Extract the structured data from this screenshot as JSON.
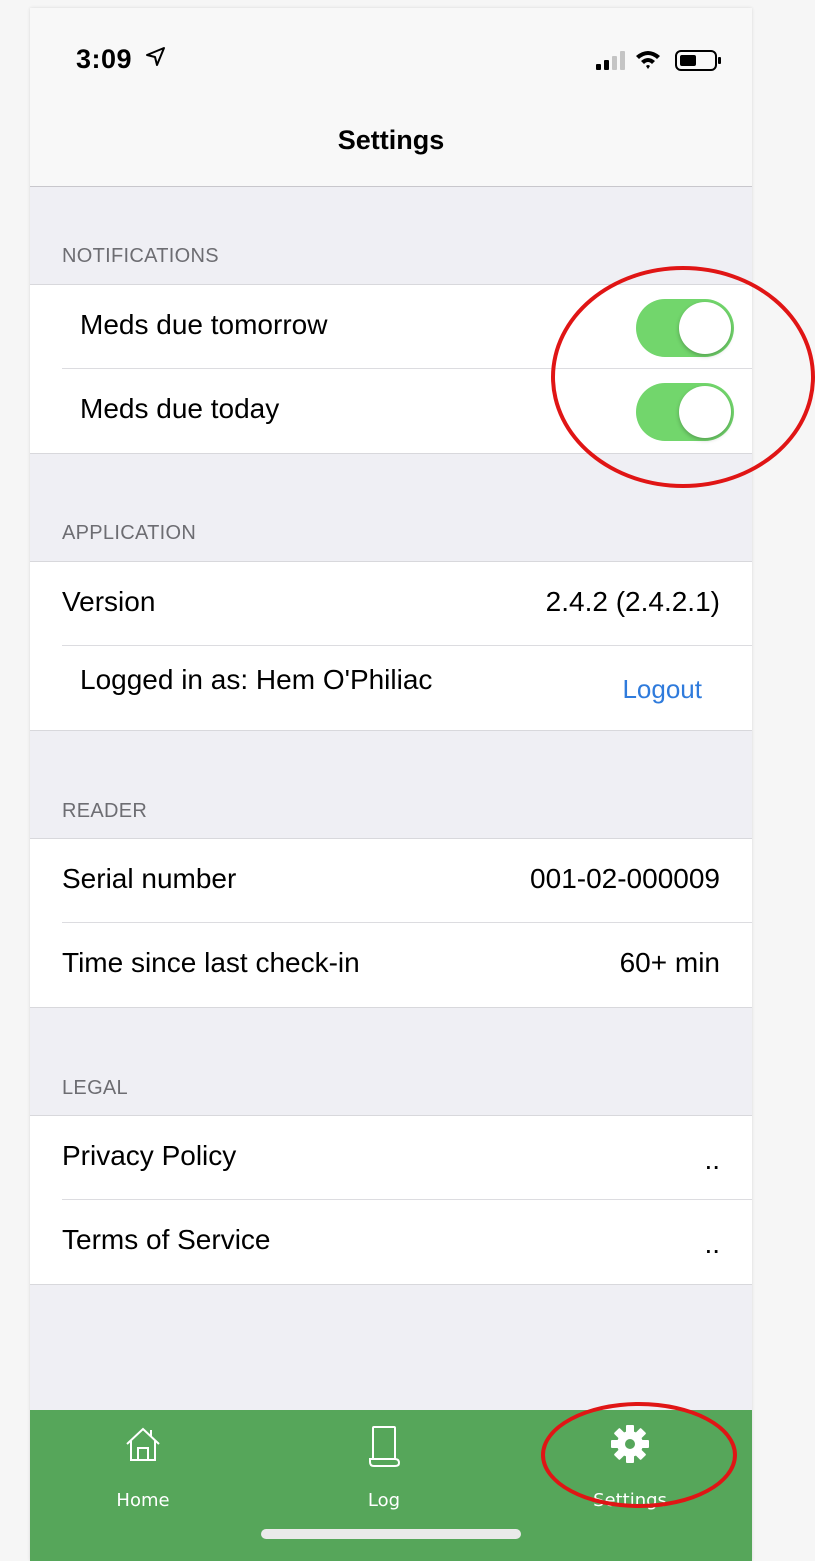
{
  "status_bar": {
    "time": "3:09",
    "location_icon": "location-arrow-icon",
    "signal_icon": "cellular-signal-icon",
    "wifi_icon": "wifi-icon",
    "battery_icon": "battery-icon"
  },
  "nav": {
    "title": "Settings"
  },
  "notifications": {
    "header": "NOTIFICATIONS",
    "items": [
      {
        "label": "Meds due tomorrow",
        "enabled": true
      },
      {
        "label": "Meds due today",
        "enabled": true
      }
    ]
  },
  "application": {
    "header": "APPLICATION",
    "version_label": "Version",
    "version_value": "2.4.2 (2.4.2.1)",
    "logged_in_label": "Logged in as: Hem O'Philiac",
    "logout_label": "Logout"
  },
  "reader": {
    "header": "READER",
    "serial_label": "Serial number",
    "serial_value": "001-02-000009",
    "checkin_label": "Time since last check-in",
    "checkin_value": "60+ min"
  },
  "legal": {
    "header": "LEGAL",
    "privacy_label": "Privacy Policy",
    "privacy_value": "..",
    "terms_label": "Terms of Service",
    "terms_value": ".."
  },
  "tabs": [
    {
      "label": "Home",
      "icon": "home-icon"
    },
    {
      "label": "Log",
      "icon": "scroll-icon"
    },
    {
      "label": "Settings",
      "icon": "gear-icon",
      "selected": true
    }
  ],
  "colors": {
    "toggle_on": "#72d66c",
    "tab_bar": "#56a65a",
    "link": "#2f7bdc",
    "annotation": "#e01515"
  }
}
